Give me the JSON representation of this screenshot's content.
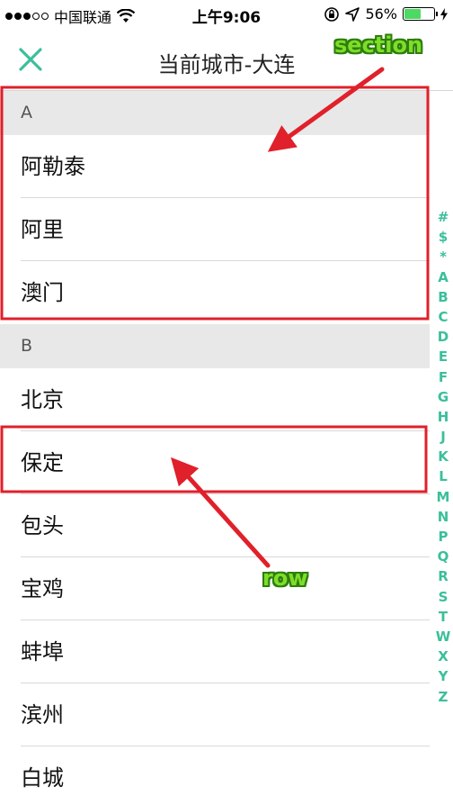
{
  "status_bar": {
    "carrier": "中国联通",
    "time": "上午9:06",
    "battery_percent": "56%",
    "battery_level": 0.56,
    "signal_bars_filled": 3,
    "signal_bars_total": 5
  },
  "nav": {
    "title": "当前城市-大连",
    "close_icon": "close-x-icon",
    "accent_color": "#3bbf9b"
  },
  "sections": [
    {
      "header": "A",
      "rows": [
        "阿勒泰",
        "阿里",
        "澳门"
      ]
    },
    {
      "header": "B",
      "rows": [
        "北京",
        "保定",
        "包头",
        "宝鸡",
        "蚌埠",
        "滨州",
        "白城"
      ]
    }
  ],
  "index_letters": [
    "#",
    "$",
    "*",
    "A",
    "B",
    "C",
    "D",
    "E",
    "F",
    "G",
    "H",
    "J",
    "K",
    "L",
    "M",
    "N",
    "P",
    "Q",
    "R",
    "S",
    "T",
    "W",
    "X",
    "Y",
    "Z"
  ],
  "annotations": {
    "section_label": "section",
    "row_label": "row",
    "box_color": "#e0202a",
    "label_color": "#7ede28"
  }
}
